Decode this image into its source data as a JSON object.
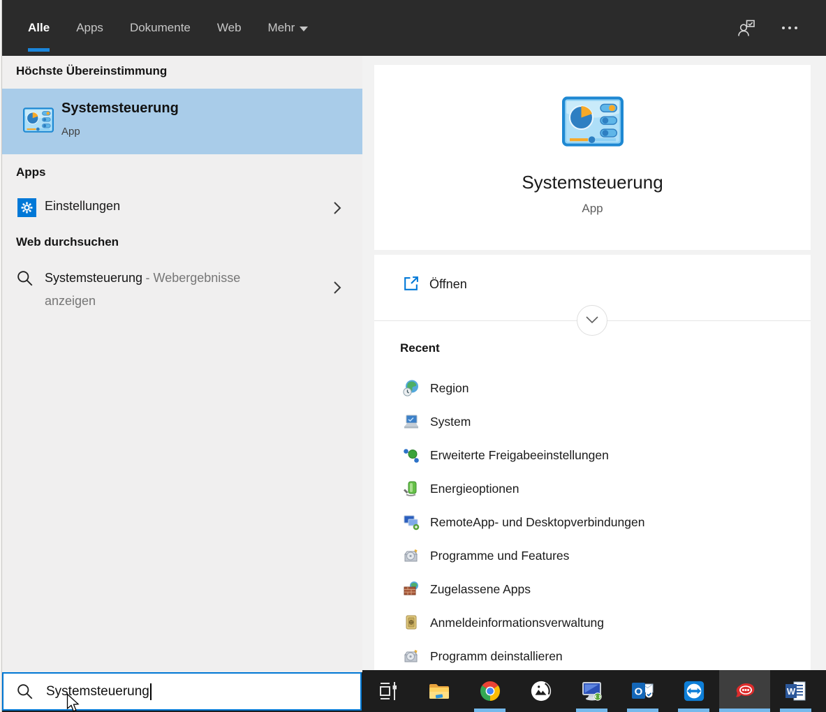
{
  "topbar": {
    "tabs": [
      {
        "label": "Alle",
        "active": true
      },
      {
        "label": "Apps",
        "active": false
      },
      {
        "label": "Dokumente",
        "active": false
      },
      {
        "label": "Web",
        "active": false
      },
      {
        "label": "Mehr",
        "active": false,
        "dropdown": true
      }
    ],
    "icons": [
      "feedback-user",
      "ellipsis"
    ]
  },
  "left_panel": {
    "best_match_header": "Höchste Übereinstimmung",
    "best_match": {
      "title": "Systemsteuerung",
      "type": "App",
      "icon": "control-panel"
    },
    "apps_header": "Apps",
    "apps_items": [
      {
        "label": "Einstellungen",
        "icon": "settings-gear"
      }
    ],
    "web_header": "Web durchsuchen",
    "web_result": {
      "query": "Systemsteuerung",
      "suffix_line1": "- Webergebnisse",
      "suffix_line2": "anzeigen",
      "icon": "search"
    }
  },
  "right_panel": {
    "app_card": {
      "title": "Systemsteuerung",
      "type": "App",
      "icon": "control-panel"
    },
    "open_action": {
      "label": "Öffnen",
      "icon": "open-external"
    },
    "recent_header": "Recent",
    "recent_items": [
      {
        "label": "Region",
        "icon": "globe-clock"
      },
      {
        "label": "System",
        "icon": "computer"
      },
      {
        "label": "Erweiterte Freigabeeinstellungen",
        "icon": "network-share"
      },
      {
        "label": "Energieoptionen",
        "icon": "power-battery"
      },
      {
        "label": "RemoteApp- und Desktopverbindungen",
        "icon": "remote-desktop"
      },
      {
        "label": "Programme und Features",
        "icon": "program-box"
      },
      {
        "label": "Zugelassene Apps",
        "icon": "firewall-wall"
      },
      {
        "label": "Anmeldeinformationsverwaltung",
        "icon": "credential-safe"
      },
      {
        "label": "Programm deinstallieren",
        "icon": "program-box"
      }
    ]
  },
  "search": {
    "value": "Systemsteuerung",
    "icon": "search"
  },
  "taskbar": {
    "items": [
      {
        "icon": "task-view-icon",
        "running": false,
        "active": false
      },
      {
        "icon": "file-explorer-icon",
        "running": false,
        "active": false
      },
      {
        "icon": "chrome-icon",
        "running": true,
        "active": false
      },
      {
        "icon": "photos-icon",
        "running": false,
        "active": false
      },
      {
        "icon": "remote-desktop-icon",
        "running": true,
        "active": false
      },
      {
        "icon": "outlook-icon",
        "running": true,
        "active": false
      },
      {
        "icon": "teamviewer-icon",
        "running": true,
        "active": false
      },
      {
        "icon": "rocket-chat-icon",
        "running": true,
        "active": true
      },
      {
        "icon": "word-icon",
        "running": true,
        "active": false
      }
    ]
  },
  "colors": {
    "accent": "#0078D7",
    "selection_blue": "#A9CCE9",
    "topbar_bg": "#2B2B2B",
    "taskbar_bg": "#1D1D1D",
    "taskbar_underline": "#75B9EC",
    "panel_gray": "#F1F0F0"
  }
}
